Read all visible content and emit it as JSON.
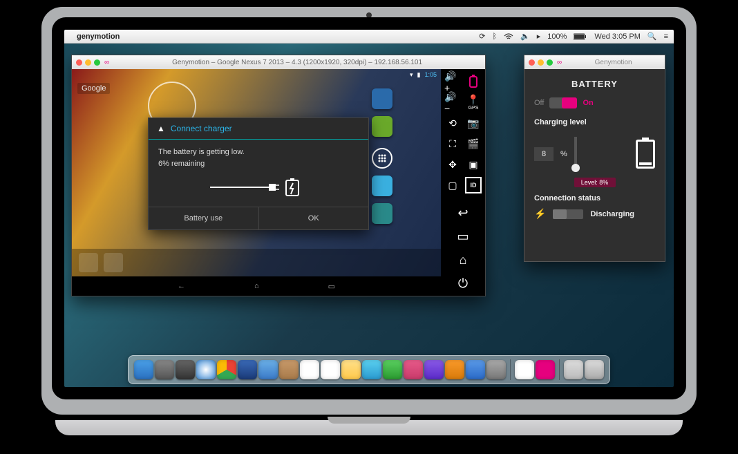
{
  "menubar": {
    "app_name": "genymotion",
    "battery_pct": "100%",
    "clock": "Wed 3:05 PM"
  },
  "emulator": {
    "title": "Genymotion – Google Nexus 7 2013 – 4.3 (1200x1920, 320dpi) – 192.168.56.101",
    "status_time": "1:05",
    "google_label": "Google",
    "dialog": {
      "title": "Connect charger",
      "line1": "The battery is getting low.",
      "line2": "6% remaining",
      "btn_left": "Battery use",
      "btn_right": "OK"
    },
    "side_labels": {
      "gps": "GPS",
      "id": "ID"
    }
  },
  "battery_panel": {
    "window_title": "Genymotion",
    "header": "BATTERY",
    "off_label": "Off",
    "on_label": "On",
    "charging_label": "Charging level",
    "percent_value": "8",
    "percent_unit": "%",
    "level_badge": "Level: 8%",
    "connection_label": "Connection status",
    "connection_value": "Discharging"
  }
}
